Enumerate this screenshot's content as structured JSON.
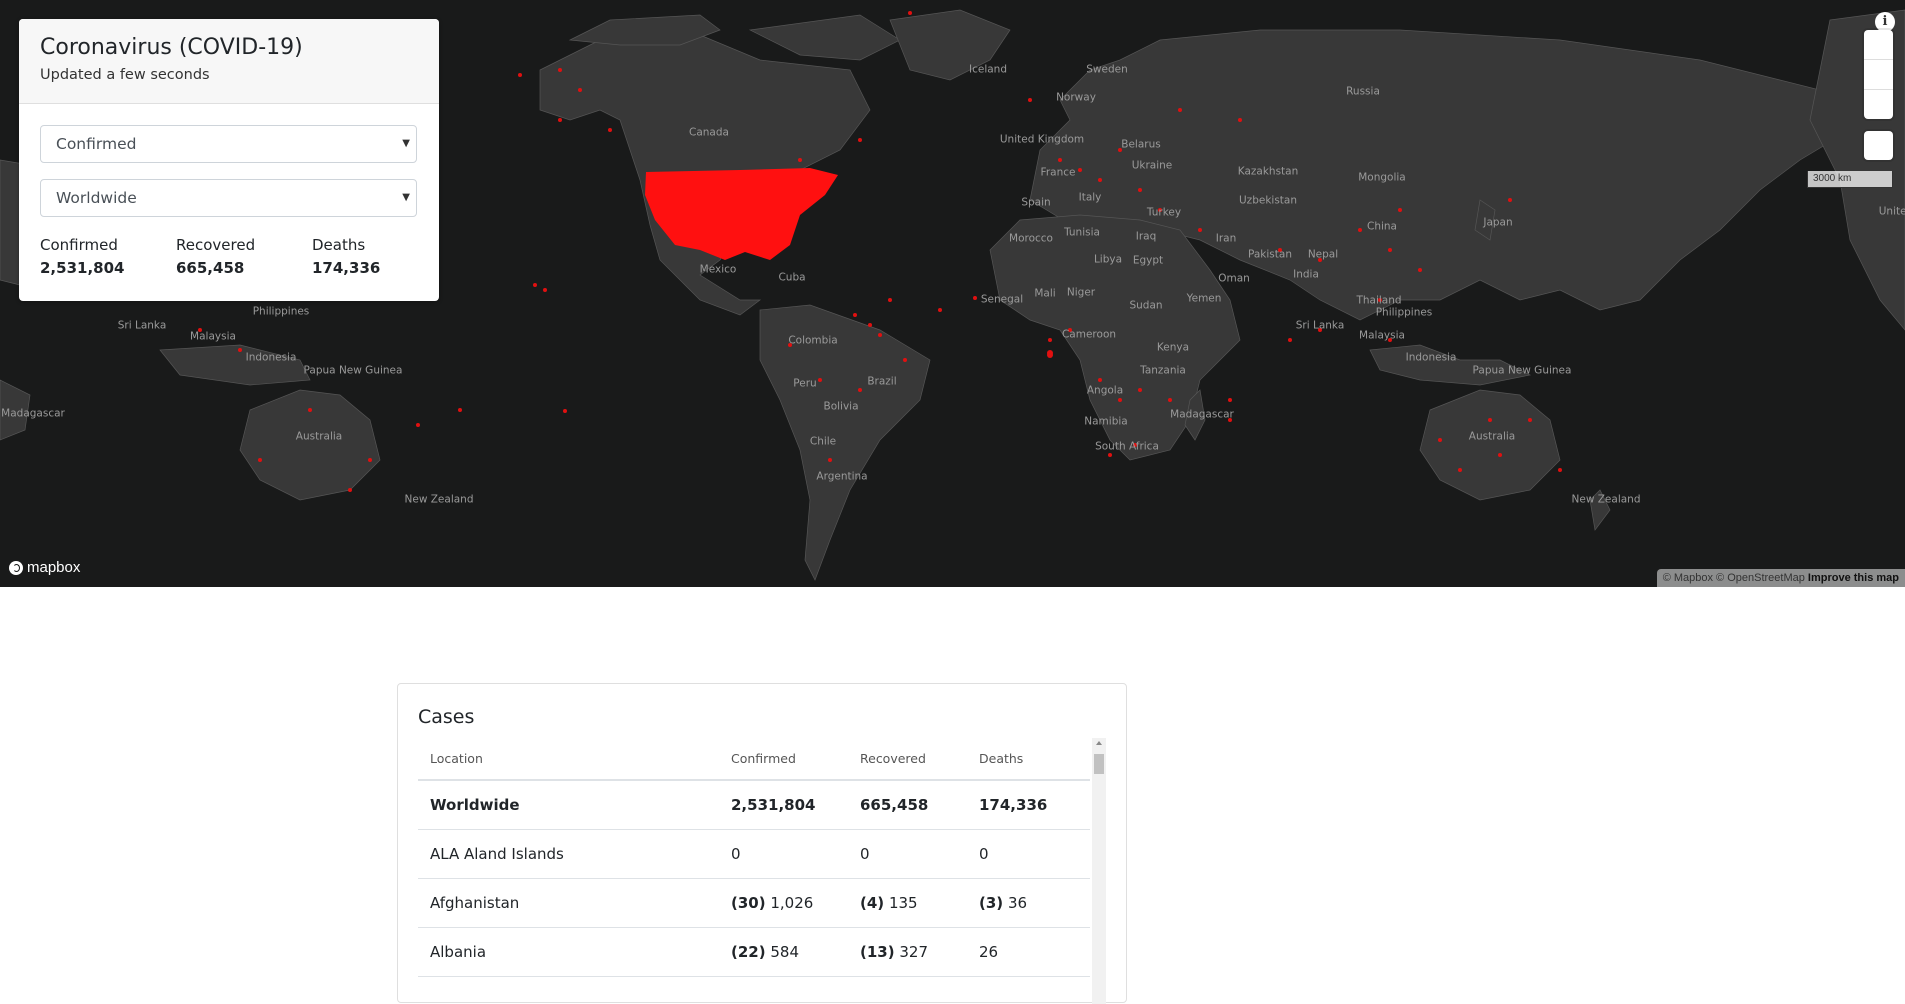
{
  "summary": {
    "title": "Coronavirus (COVID-19)",
    "updated": "Updated a few seconds",
    "metric_select": "Confirmed",
    "region_select": "Worldwide",
    "stats": [
      {
        "label": "Confirmed",
        "value": "2,531,804"
      },
      {
        "label": "Recovered",
        "value": "665,458"
      },
      {
        "label": "Deaths",
        "value": "174,336"
      }
    ]
  },
  "map": {
    "scale_label": "3000 km",
    "logo": "mapbox",
    "attribution": "© Mapbox © OpenStreetMap",
    "improve_link": "Improve this map",
    "info_icon": "i",
    "labels": [
      {
        "text": "Iceland"
      },
      {
        "text": "Sweden"
      },
      {
        "text": "Norway"
      },
      {
        "text": "Russia"
      },
      {
        "text": "United Kingdom"
      },
      {
        "text": "Belarus"
      },
      {
        "text": "Ukraine"
      },
      {
        "text": "Kazakhstan"
      },
      {
        "text": "Mongolia"
      },
      {
        "text": "France"
      },
      {
        "text": "Italy"
      },
      {
        "text": "Spain"
      },
      {
        "text": "Uzbekistan"
      },
      {
        "text": "Turkey"
      },
      {
        "text": "Iraq"
      },
      {
        "text": "Iran"
      },
      {
        "text": "China"
      },
      {
        "text": "Japan"
      },
      {
        "text": "Tunisia"
      },
      {
        "text": "Morocco"
      },
      {
        "text": "Libya"
      },
      {
        "text": "Egypt"
      },
      {
        "text": "Pakistan"
      },
      {
        "text": "Nepal"
      },
      {
        "text": "India"
      },
      {
        "text": "Oman"
      },
      {
        "text": "Yemen"
      },
      {
        "text": "Sudan"
      },
      {
        "text": "Mali"
      },
      {
        "text": "Niger"
      },
      {
        "text": "Senegal"
      },
      {
        "text": "Thailand"
      },
      {
        "text": "Philippines"
      },
      {
        "text": "Sri Lanka"
      },
      {
        "text": "Malaysia"
      },
      {
        "text": "Indonesia"
      },
      {
        "text": "Cameroon"
      },
      {
        "text": "Kenya"
      },
      {
        "text": "Tanzania"
      },
      {
        "text": "Angola"
      },
      {
        "text": "Namibia"
      },
      {
        "text": "Madagascar"
      },
      {
        "text": "South Africa"
      },
      {
        "text": "Papua New Guinea"
      },
      {
        "text": "Australia"
      },
      {
        "text": "New Zealand"
      },
      {
        "text": "Canada"
      },
      {
        "text": "Mexico"
      },
      {
        "text": "Cuba"
      },
      {
        "text": "Colombia"
      },
      {
        "text": "Peru"
      },
      {
        "text": "Brazil"
      },
      {
        "text": "Bolivia"
      },
      {
        "text": "Chile"
      },
      {
        "text": "Argentina"
      },
      {
        "text": "Philippines"
      },
      {
        "text": "Sri Lanka"
      },
      {
        "text": "Malaysia"
      },
      {
        "text": "Indonesia"
      },
      {
        "text": "Papua New Guinea"
      },
      {
        "text": "Australia"
      },
      {
        "text": "New Zealand"
      },
      {
        "text": "Madagascar"
      },
      {
        "text": "United"
      }
    ]
  },
  "cases": {
    "title": "Cases",
    "columns": [
      "Location",
      "Confirmed",
      "Recovered",
      "Deaths"
    ],
    "rows": [
      {
        "location": "Worldwide",
        "confirmed_delta": "",
        "confirmed": "2,531,804",
        "recovered_delta": "",
        "recovered": "665,458",
        "deaths_delta": "",
        "deaths": "174,336"
      },
      {
        "location": "ALA Aland Islands",
        "confirmed_delta": "",
        "confirmed": "0",
        "recovered_delta": "",
        "recovered": "0",
        "deaths_delta": "",
        "deaths": "0"
      },
      {
        "location": "Afghanistan",
        "confirmed_delta": "(30)",
        "confirmed": "1,026",
        "recovered_delta": "(4)",
        "recovered": "135",
        "deaths_delta": "(3)",
        "deaths": "36"
      },
      {
        "location": "Albania",
        "confirmed_delta": "(22)",
        "confirmed": "584",
        "recovered_delta": "(13)",
        "recovered": "327",
        "deaths_delta": "",
        "deaths": "26"
      }
    ]
  }
}
